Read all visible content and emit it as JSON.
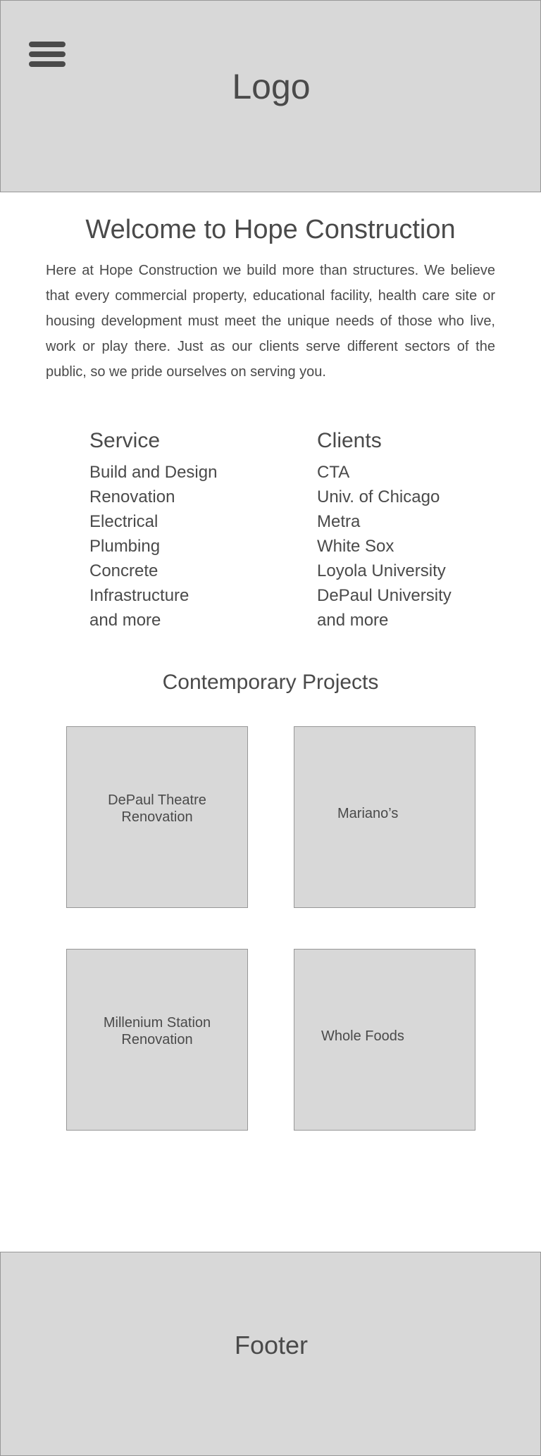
{
  "header": {
    "logo_text": "Logo",
    "menu_icon": "hamburger-menu-icon"
  },
  "welcome": {
    "title": "Welcome to Hope Construction",
    "body": "Here at Hope Construction we build more than structures. We believe that every commercial property, educational facility, health care site or housing development must meet the unique needs of those who live, work or play there. Just as our clients serve different sectors of the public, so we pride ourselves on serving you."
  },
  "services": {
    "heading": "Service",
    "items": [
      "Build and Design",
      "Renovation",
      "Electrical",
      "Plumbing",
      "Concrete",
      "Infrastructure",
      "and more"
    ]
  },
  "clients": {
    "heading": "Clients",
    "items": [
      "CTA",
      "Univ. of Chicago",
      "Metra",
      "White Sox",
      "Loyola University",
      "DePaul University",
      "and more"
    ]
  },
  "projects": {
    "title": "Contemporary Projects",
    "items": [
      {
        "label": "DePaul Theatre Renovation"
      },
      {
        "label": "Mariano’s"
      },
      {
        "label": "Millenium Station Renovation"
      },
      {
        "label": "Whole Foods"
      }
    ]
  },
  "footer": {
    "text": "Footer"
  },
  "colors": {
    "placeholder_fill": "#d8d8d8",
    "placeholder_border": "#979797",
    "text": "#4a4a4a",
    "background": "#ffffff"
  }
}
